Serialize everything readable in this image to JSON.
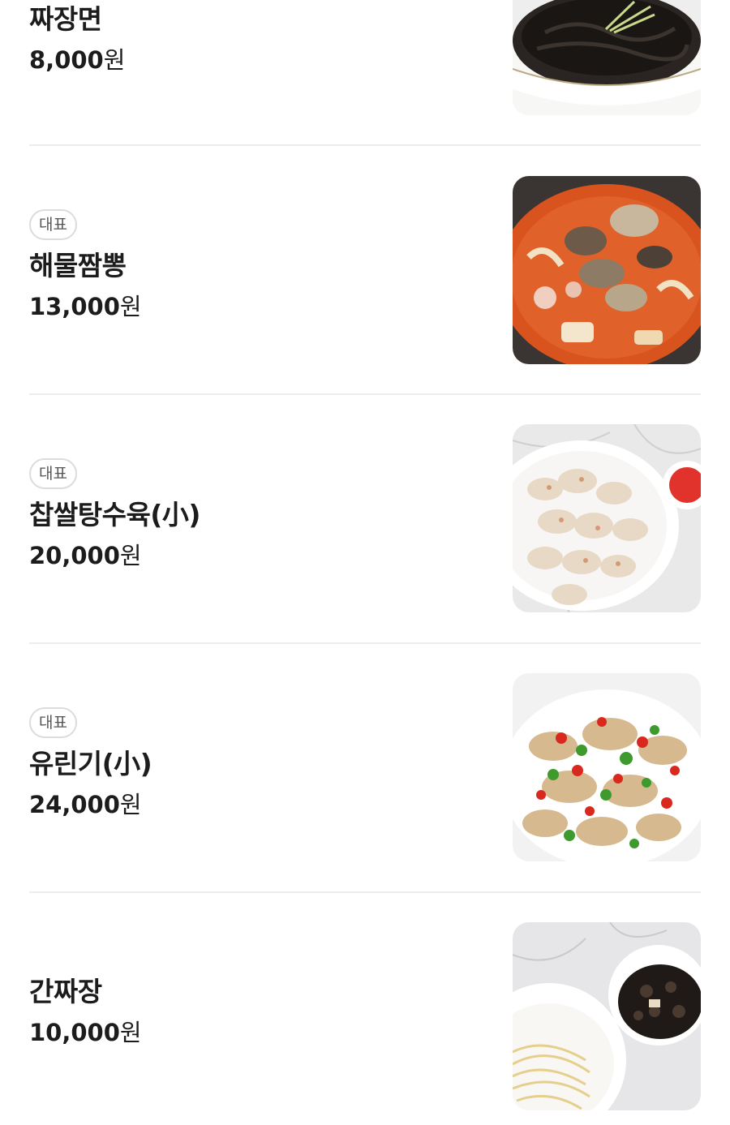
{
  "items": [
    {
      "name": "짜장면",
      "price": "8,000",
      "unit": "원",
      "badge": "",
      "dish_icon": "jajangmyeon-photo"
    },
    {
      "name": "해물짬뽕",
      "price": "13,000",
      "unit": "원",
      "badge": "대표",
      "dish_icon": "jjamppong-photo"
    },
    {
      "name": "찹쌀탕수육(小)",
      "price": "20,000",
      "unit": "원",
      "badge": "대표",
      "dish_icon": "tangsuyuk-photo"
    },
    {
      "name": "유린기(小)",
      "price": "24,000",
      "unit": "원",
      "badge": "대표",
      "dish_icon": "yuringi-photo"
    },
    {
      "name": "간짜장",
      "price": "10,000",
      "unit": "원",
      "badge": "",
      "dish_icon": "ganjjajang-photo"
    }
  ],
  "colors": {
    "text": "#1c1c1c",
    "badge_border": "#dcdcdc",
    "divider": "#ededed"
  }
}
